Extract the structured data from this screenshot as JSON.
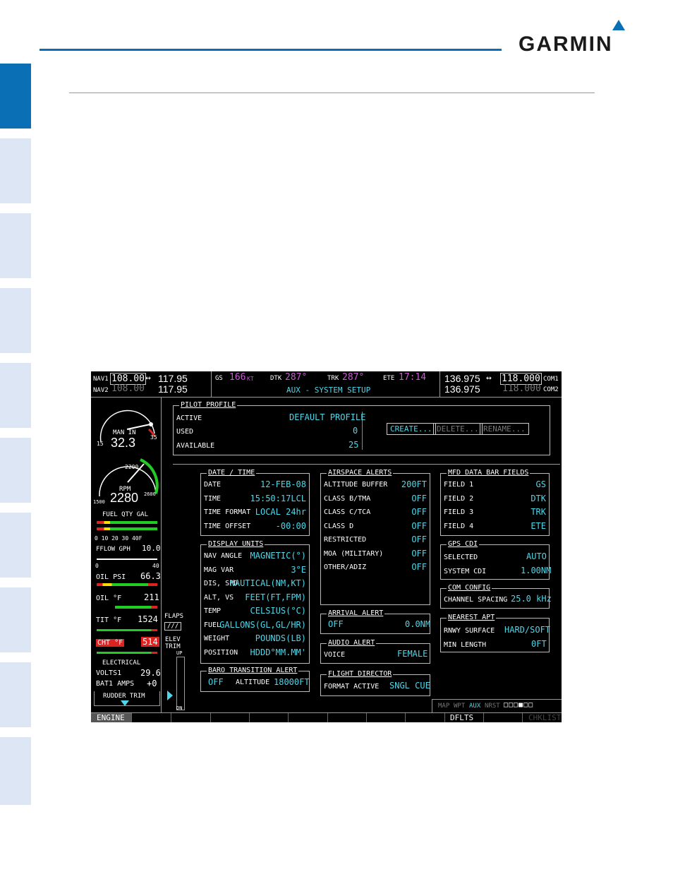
{
  "brand": "GARMIN",
  "top_bar": {
    "nav1_label": "NAV1",
    "nav1_active": "108.00",
    "nav1_standby": "117.95",
    "nav2_label": "NAV2",
    "nav2_active": "108.00",
    "nav2_standby": "117.95",
    "swap_glyph": "↔",
    "gs_label": "GS",
    "gs_value": "166",
    "gs_unit": "KT",
    "dtk_label": "DTK",
    "dtk_value": "287°",
    "trk_label": "TRK",
    "trk_value": "287°",
    "ete_label": "ETE",
    "ete_value": "17:14",
    "page_title": "AUX - SYSTEM SETUP",
    "com1_active": "136.975",
    "com1_standby": "118.000",
    "com1_label": "COM1",
    "com2_active": "136.975",
    "com2_standby": "118.000",
    "com2_label": "COM2"
  },
  "engine": {
    "man_in_label": "MAN IN",
    "man_in_value": "32.3",
    "man_in_min": "15",
    "man_in_max": "35",
    "rpm_label": "RPM",
    "rpm_value": "2280",
    "rpm_min": "1500",
    "rpm_mid": "2200",
    "rpm_max": "2600",
    "fuel_qty_label": "FUEL QTY GAL",
    "fuel_ticks": "0  10  20  30  40F",
    "fflow_label": "FFLOW GPH",
    "fflow_value": "10.0",
    "fflow_min": "0",
    "fflow_max": "40",
    "oil_psi_label": "OIL PSI",
    "oil_psi_value": "66.3",
    "oil_f_label": "OIL °F",
    "oil_f_value": "211",
    "tit_label": "TIT °F",
    "tit_value": "1524",
    "cht_label": "CHT °F",
    "cht_value": "514",
    "electrical_label": "ELECTRICAL",
    "volts_label": "VOLTS1",
    "volts_value": "29.6",
    "amps_label": "BAT1 AMPS",
    "amps_value": "+0",
    "rudder_label": "RUDDER TRIM",
    "flaps_label": "FLAPS",
    "flaps_value": "///",
    "elev_label": "ELEV TRIM",
    "elev_up": "UP",
    "elev_dn": "DN"
  },
  "pilot_profile": {
    "title": "PILOT PROFILE",
    "active_label": "ACTIVE",
    "active_value": "DEFAULT PROFILE",
    "used_label": "USED",
    "used_value": "0",
    "available_label": "AVAILABLE",
    "available_value": "25",
    "create": "CREATE...",
    "delete": "DELETE...",
    "rename": "RENAME..."
  },
  "date_time": {
    "title": "DATE / TIME",
    "rows": [
      {
        "label": "DATE",
        "value": "12-FEB-08"
      },
      {
        "label": "TIME",
        "value": "15:50:17LCL"
      },
      {
        "label": "TIME FORMAT",
        "value": "LOCAL 24hr"
      },
      {
        "label": "TIME OFFSET",
        "value": "-00:00"
      }
    ]
  },
  "display_units": {
    "title": "DISPLAY UNITS",
    "rows": [
      {
        "label": "NAV ANGLE",
        "value": "MAGNETIC(°)"
      },
      {
        "label": "MAG VAR",
        "value": "3°E"
      },
      {
        "label": "DIS, SPD",
        "value": "NAUTICAL(NM,KT)"
      },
      {
        "label": "ALT, VS",
        "value": "FEET(FT,FPM)"
      },
      {
        "label": "TEMP",
        "value": "CELSIUS(°C)"
      },
      {
        "label": "FUEL",
        "value": "GALLONS(GL,GL/HR)"
      },
      {
        "label": "WEIGHT",
        "value": "POUNDS(LB)"
      },
      {
        "label": "POSITION",
        "value": "HDDD°MM.MM'"
      }
    ]
  },
  "baro_alert": {
    "title": "BARO TRANSITION ALERT",
    "state": "OFF",
    "alt_label": "ALTITUDE",
    "alt_value": "18000FT"
  },
  "airspace_alerts": {
    "title": "AIRSPACE ALERTS",
    "rows": [
      {
        "label": "ALTITUDE BUFFER",
        "value": "200FT"
      },
      {
        "label": "CLASS B/TMA",
        "value": "OFF"
      },
      {
        "label": "CLASS C/TCA",
        "value": "OFF"
      },
      {
        "label": "CLASS D",
        "value": "OFF"
      },
      {
        "label": "RESTRICTED",
        "value": "OFF"
      },
      {
        "label": "MOA (MILITARY)",
        "value": "OFF"
      },
      {
        "label": "OTHER/ADIZ",
        "value": "OFF"
      }
    ]
  },
  "arrival_alert": {
    "title": "ARRIVAL ALERT",
    "state": "OFF",
    "value": "0.0NM"
  },
  "audio_alert": {
    "title": "AUDIO ALERT",
    "label": "VOICE",
    "value": "FEMALE"
  },
  "flight_director": {
    "title": "FLIGHT DIRECTOR",
    "label": "FORMAT ACTIVE",
    "value": "SNGL CUE"
  },
  "mfd_fields": {
    "title": "MFD DATA BAR FIELDS",
    "rows": [
      {
        "label": "FIELD 1",
        "value": "GS"
      },
      {
        "label": "FIELD 2",
        "value": "DTK"
      },
      {
        "label": "FIELD 3",
        "value": "TRK"
      },
      {
        "label": "FIELD 4",
        "value": "ETE"
      }
    ]
  },
  "gps_cdi": {
    "title": "GPS CDI",
    "sel_label": "SELECTED",
    "sel_value": "AUTO",
    "sys_label": "SYSTEM CDI",
    "sys_value": "1.00NM"
  },
  "com_config": {
    "title": "COM CONFIG",
    "label": "CHANNEL SPACING",
    "value": "25.0 kHz"
  },
  "nearest_apt": {
    "title": "NEAREST APT",
    "surf_label": "RNWY SURFACE",
    "surf_value": "HARD/SOFT",
    "len_label": "MIN LENGTH",
    "len_value": "0FT"
  },
  "page_group": {
    "map": "MAP",
    "wpt": "WPT",
    "aux": "AUX",
    "nrst": "NRST"
  },
  "softkeys": {
    "engine": "ENGINE",
    "dflts": "DFLTS",
    "checklist": "CHKLIST"
  }
}
